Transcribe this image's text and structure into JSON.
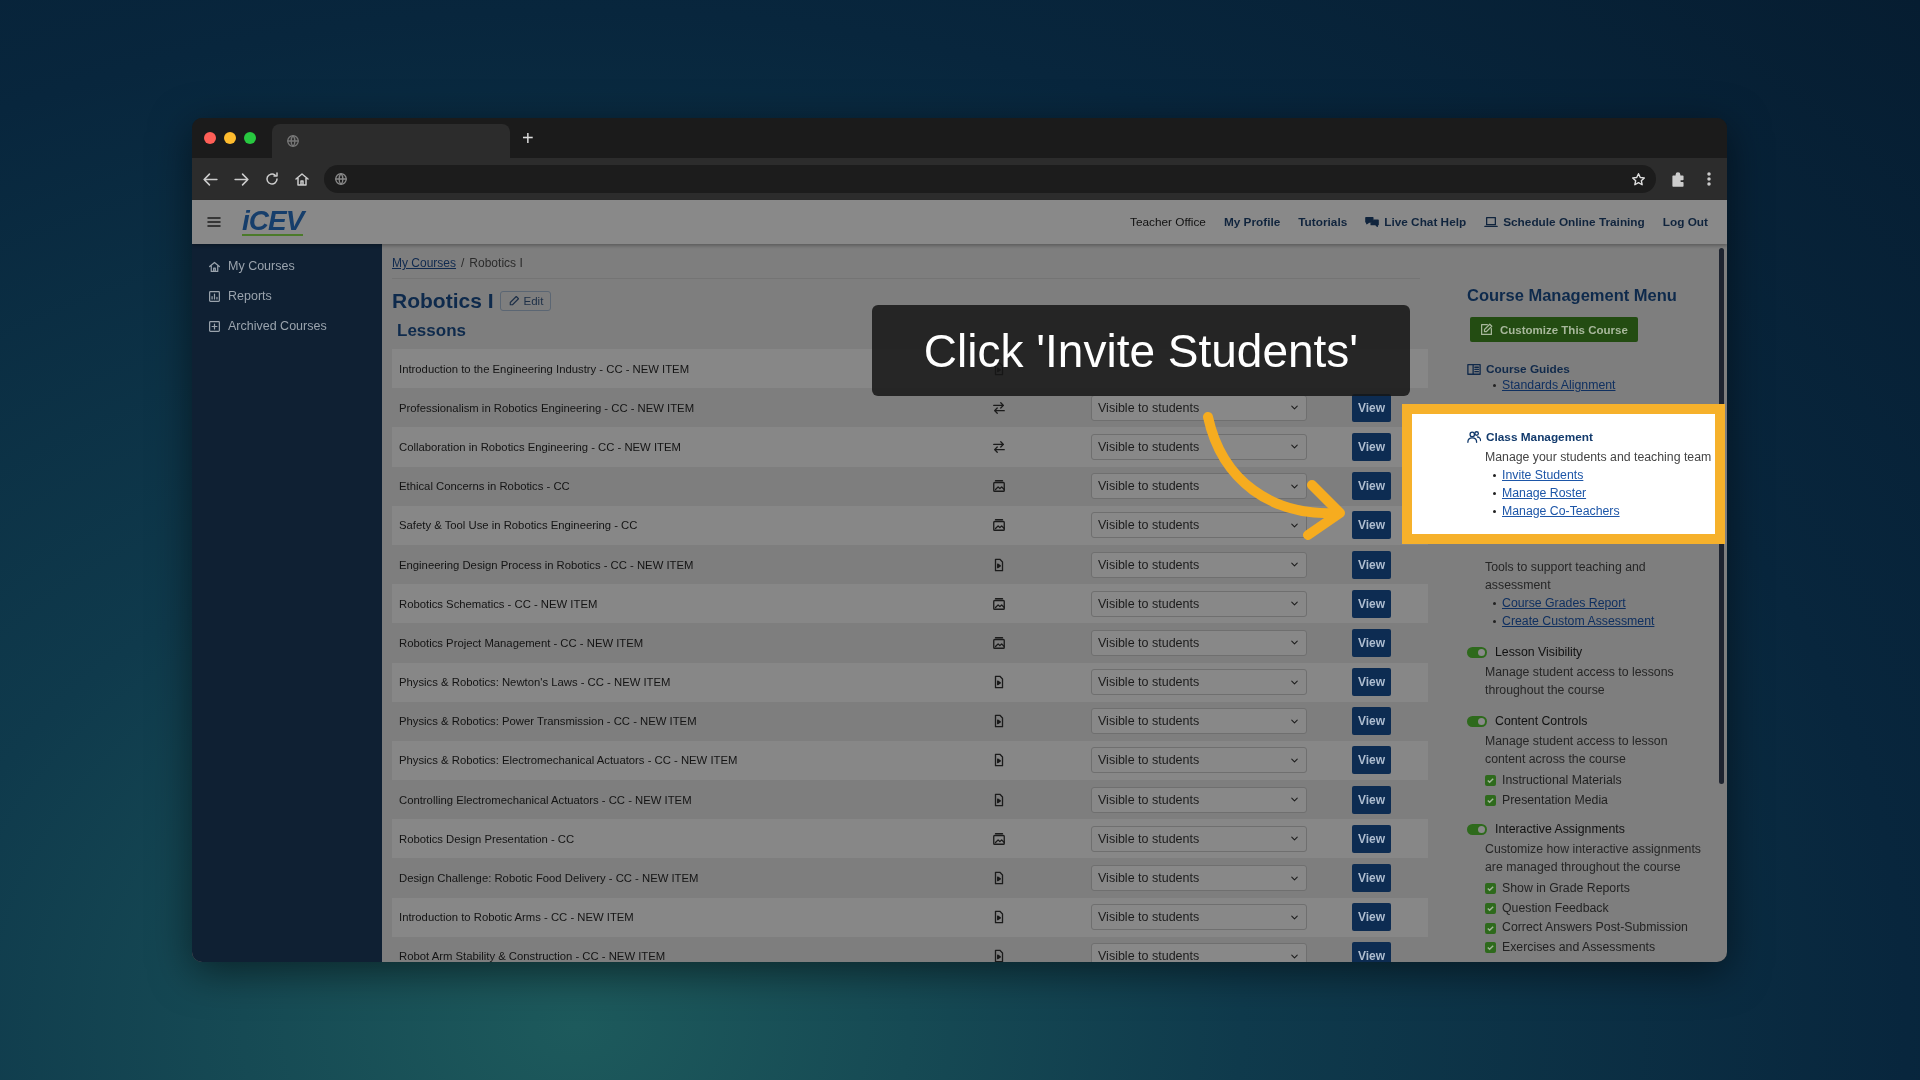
{
  "browser": {
    "new_tab": "+"
  },
  "header": {
    "logo": "iCEV",
    "nav": [
      {
        "label": "Teacher Office",
        "kind": "plain"
      },
      {
        "label": "My Profile",
        "kind": "bold"
      },
      {
        "label": "Tutorials",
        "kind": "bold"
      },
      {
        "label": "Live Chat Help",
        "kind": "chat"
      },
      {
        "label": "Schedule Online Training",
        "kind": "laptop"
      },
      {
        "label": "Log Out",
        "kind": "bold"
      }
    ]
  },
  "sidebar": {
    "items": [
      {
        "label": "My Courses"
      },
      {
        "label": "Reports"
      },
      {
        "label": "Archived Courses"
      }
    ]
  },
  "breadcrumb": {
    "separator": "/",
    "items": [
      {
        "label": "My Courses",
        "kind": "link"
      },
      {
        "label": "Robotics I",
        "kind": "current"
      }
    ]
  },
  "course": {
    "title": "Robotics I",
    "edit_button": "Edit"
  },
  "lessons": {
    "heading": "Lessons",
    "rows": [
      {
        "name": "Introduction to the Engineering Industry - CC - NEW ITEM",
        "kind": "document"
      },
      {
        "name": "Professionalism in Robotics Engineering - CC - NEW ITEM",
        "kind": "swap",
        "visibility": "Visible to students",
        "action": "View"
      },
      {
        "name": "Collaboration in Robotics Engineering - CC - NEW ITEM",
        "kind": "swap",
        "visibility": "Visible to students",
        "action": "View"
      },
      {
        "name": "Ethical Concerns in Robotics - CC",
        "kind": "media",
        "visibility": "Visible to students",
        "action": "View"
      },
      {
        "name": "Safety & Tool Use in Robotics Engineering - CC",
        "kind": "media",
        "visibility": "Visible to students",
        "action": "View"
      },
      {
        "name": "Engineering Design Process in Robotics - CC - NEW ITEM",
        "kind": "document",
        "visibility": "Visible to students",
        "action": "View"
      },
      {
        "name": "Robotics Schematics - CC - NEW ITEM",
        "kind": "media",
        "visibility": "Visible to students",
        "action": "View"
      },
      {
        "name": "Robotics Project Management - CC - NEW ITEM",
        "kind": "media",
        "visibility": "Visible to students",
        "action": "View"
      },
      {
        "name": "Physics & Robotics: Newton's Laws - CC - NEW ITEM",
        "kind": "document",
        "visibility": "Visible to students",
        "action": "View"
      },
      {
        "name": "Physics & Robotics: Power Transmission - CC - NEW ITEM",
        "kind": "document",
        "visibility": "Visible to students",
        "action": "View"
      },
      {
        "name": "Physics & Robotics: Electromechanical Actuators - CC - NEW ITEM",
        "kind": "document",
        "visibility": "Visible to students",
        "action": "View"
      },
      {
        "name": "Controlling Electromechanical Actuators - CC - NEW ITEM",
        "kind": "document",
        "visibility": "Visible to students",
        "action": "View"
      },
      {
        "name": "Robotics Design Presentation - CC",
        "kind": "media",
        "visibility": "Visible to students",
        "action": "View"
      },
      {
        "name": "Design Challenge: Robotic Food Delivery - CC - NEW ITEM",
        "kind": "document",
        "visibility": "Visible to students",
        "action": "View"
      },
      {
        "name": "Introduction to Robotic Arms - CC - NEW ITEM",
        "kind": "document",
        "visibility": "Visible to students",
        "action": "View"
      },
      {
        "name": "Robot Arm Stability & Construction - CC - NEW ITEM",
        "kind": "document",
        "visibility": "Visible to students",
        "action": "View"
      }
    ]
  },
  "menu": {
    "title": "Course Management Menu",
    "customize_button": "Customize This Course",
    "sections": [
      {
        "kind": "links",
        "title": "Course Guides",
        "highlighted": false,
        "links": [
          "Standards Alignment"
        ]
      },
      {
        "kind": "links",
        "title": "Class Management",
        "highlighted": true,
        "description": "Manage your students and teaching team",
        "links": [
          "Invite Students",
          "Manage Roster",
          "Manage Co-Teachers"
        ]
      },
      {
        "kind": "links",
        "highlighted": false,
        "description": "Tools to support teaching and assessment",
        "links": [
          "Course Grades Report",
          "Create Custom Assessment"
        ]
      },
      {
        "kind": "toggle",
        "title": "Lesson Visibility",
        "on": true,
        "description": "Manage student access to lessons throughout the course"
      },
      {
        "kind": "toggle",
        "title": "Content Controls",
        "on": true,
        "description": "Manage student access to lesson content across the course",
        "options": [
          {
            "label": "Instructional Materials",
            "checked": true
          },
          {
            "label": "Presentation Media",
            "checked": true
          }
        ]
      },
      {
        "kind": "toggle",
        "title": "Interactive Assignments",
        "on": true,
        "description": "Customize how interactive assignments are managed throughout the course",
        "options": [
          {
            "label": "Show in Grade Reports",
            "checked": true
          },
          {
            "label": "Question Feedback",
            "checked": true
          },
          {
            "label": "Correct Answers Post-Submission",
            "checked": true
          },
          {
            "label": "Exercises and Assessments",
            "checked": true
          }
        ]
      }
    ]
  },
  "callout": {
    "text": "Click 'Invite Students'"
  }
}
